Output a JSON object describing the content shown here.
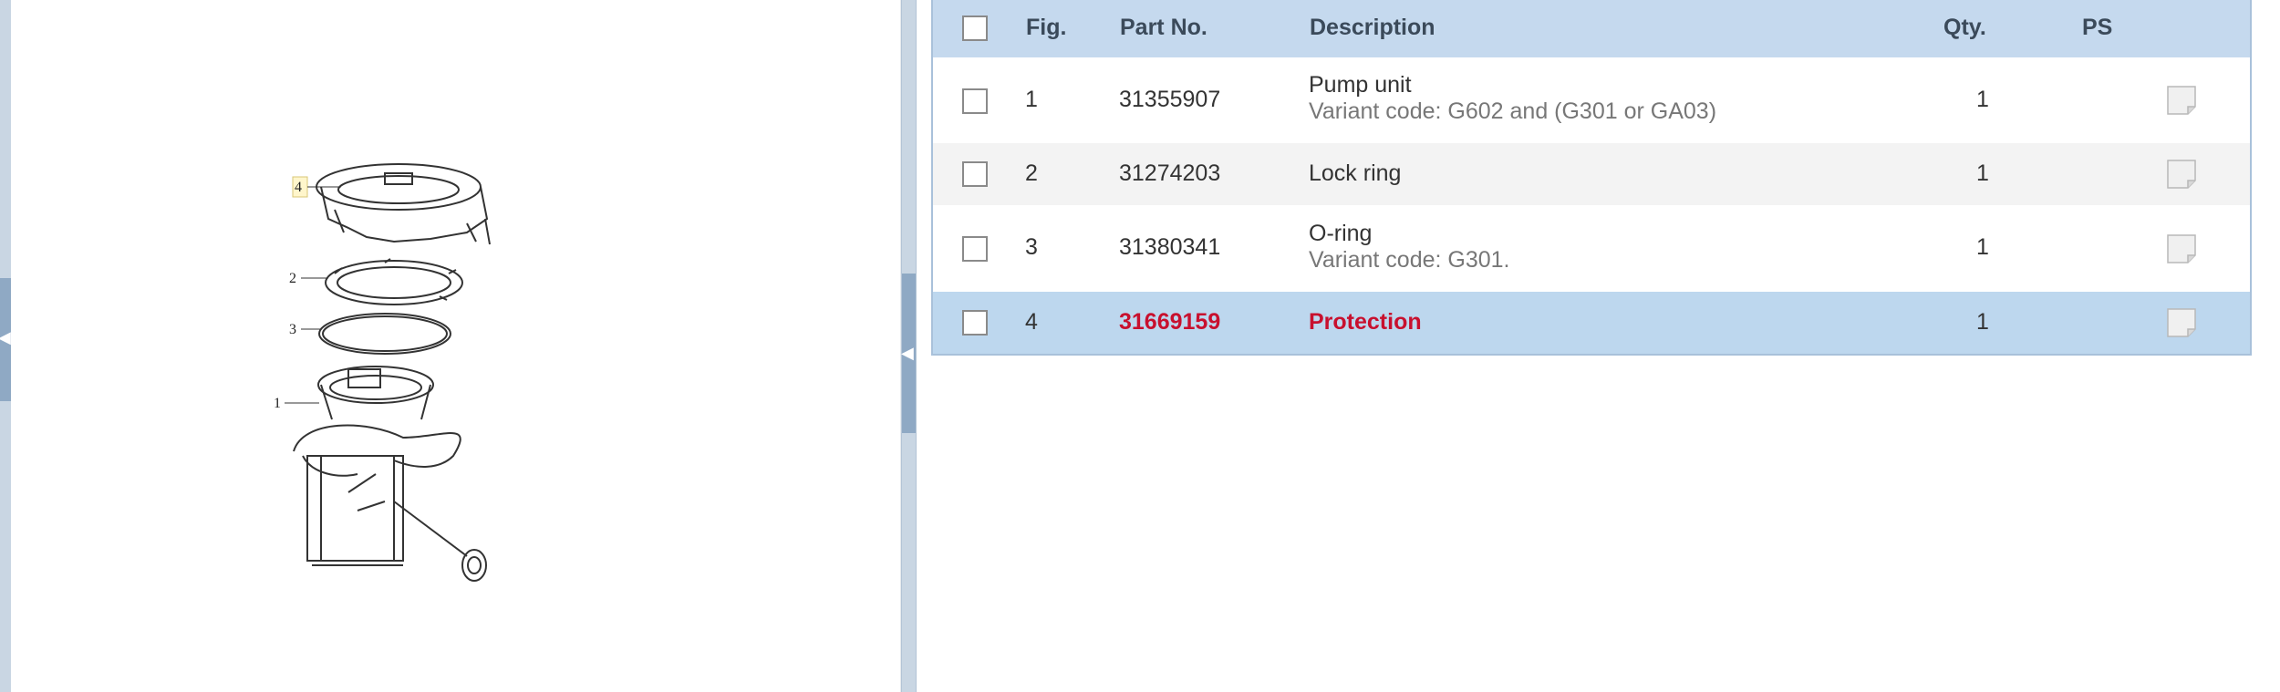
{
  "diagram": {
    "callouts": [
      "4",
      "2",
      "3",
      "1"
    ]
  },
  "table": {
    "headers": {
      "fig": "Fig.",
      "part_no": "Part No.",
      "description": "Description",
      "qty": "Qty.",
      "ps": "PS"
    },
    "rows": [
      {
        "fig": "1",
        "part_no": "31355907",
        "description": "Pump unit",
        "variant": "Variant code: G602 and (G301 or GA03)",
        "qty": "1"
      },
      {
        "fig": "2",
        "part_no": "31274203",
        "description": "Lock ring",
        "variant": "",
        "qty": "1"
      },
      {
        "fig": "3",
        "part_no": "31380341",
        "description": "O-ring",
        "variant": "Variant code: G301.",
        "qty": "1"
      },
      {
        "fig": "4",
        "part_no": "31669159",
        "description": "Protection",
        "variant": "",
        "qty": "1",
        "selected": true
      }
    ]
  },
  "colors": {
    "header_bg": "#c5d9ee",
    "selected_row_bg": "#bdd7ee",
    "selected_text": "#c8102e",
    "splitter": "#c9d6e3"
  }
}
